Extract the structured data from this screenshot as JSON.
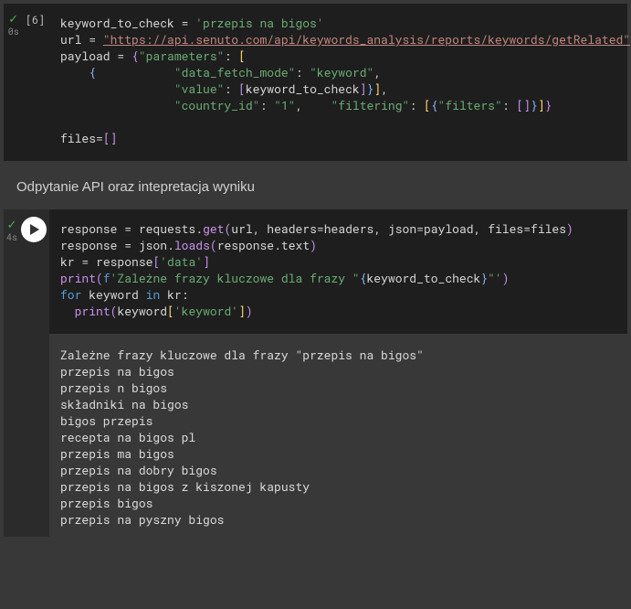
{
  "cell1": {
    "status_icon": "✓",
    "time": "0s",
    "number": "[6]",
    "code": {
      "l1_var": "keyword_to_check",
      "l1_eq": " = ",
      "l1_str": "'przepis na bigos'",
      "l2_var": "url",
      "l2_eq": " = ",
      "l2_str": "\"https://api.senuto.com/api/keywords_analysis/reports/keywords/getRelated\"",
      "l3_var": "payload",
      "l3_eq": " = ",
      "l3_key_params": "\"parameters\"",
      "l4_key_dfm": "\"data_fetch_mode\"",
      "l4_val_dfm": "\"keyword\"",
      "l5_key_val": "\"value\"",
      "l5_var_ref": "keyword_to_check",
      "l6_key_cid": "\"country_id\"",
      "l6_val_cid": "\"1\"",
      "l6_key_filt": "\"filtering\"",
      "l6_key_filters": "\"filters\"",
      "l8_var": "files",
      "l8_eq": "="
    }
  },
  "section_title": "Odpytanie API oraz intepretacja wyniku",
  "cell2": {
    "status_icon": "✓",
    "time": "4s",
    "code": {
      "l1_var": "response",
      "l1_eq": " = ",
      "l1_mod": "requests",
      "l1_fn": "get",
      "l1_a1": "url",
      "l1_kw1": "headers",
      "l1_kv1": "headers",
      "l1_kw2": "json",
      "l1_kv2": "payload",
      "l1_kw3": "files",
      "l1_kv3": "files",
      "l2_var": "response",
      "l2_eq": " = ",
      "l2_mod": "json",
      "l2_fn": "loads",
      "l2_arg_obj": "response",
      "l2_arg_prop": "text",
      "l3_var": "kr",
      "l3_eq": " = ",
      "l3_obj": "response",
      "l3_key": "'data'",
      "l4_fn": "print",
      "l4_f": "f",
      "l4_s1": "'Zależne frazy kluczowe dla frazy \"",
      "l4_expr": "keyword_to_check",
      "l4_s2": "\"'",
      "l5_for": "for",
      "l5_var": "keyword",
      "l5_in": "in",
      "l5_it": "kr",
      "l6_fn": "print",
      "l6_obj": "keyword",
      "l6_key": "'keyword'"
    },
    "output": [
      "Zależne frazy kluczowe dla frazy \"przepis na bigos\"",
      "przepis na bigos",
      "przepis n bigos",
      "składniki na bigos",
      "bigos przepis",
      "recepta na bigos pl",
      "przepis ma bigos",
      "przepis na dobry bigos",
      "przepis na bigos z kiszonej kapusty",
      "przepis bigos",
      "przepis na pyszny bigos"
    ]
  }
}
